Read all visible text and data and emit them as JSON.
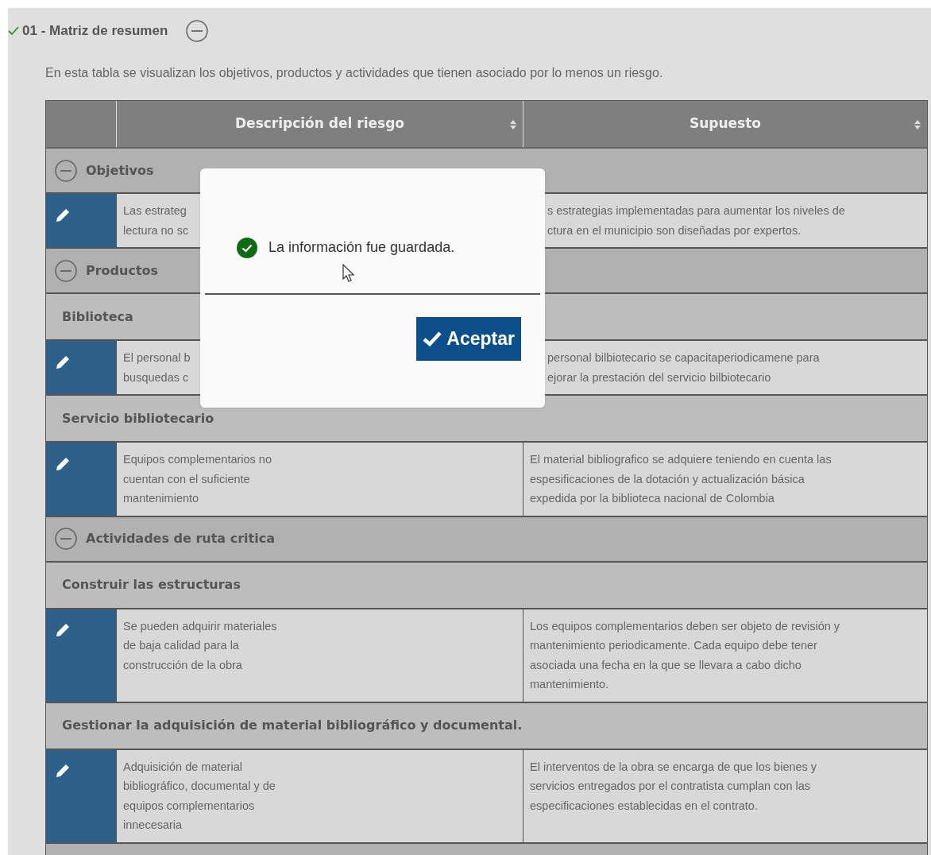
{
  "section": {
    "title": "01 - Matriz de resumen",
    "completed": true,
    "expanded": true
  },
  "description": "En esta tabla se visualizan los objetivos, productos y actividades que tienen asociado por lo menos un riesgo.",
  "table": {
    "columns": [
      "Descripción del riesgo",
      "Supuesto"
    ],
    "rows": [
      {
        "kind": "group",
        "label": "Objetivos",
        "expanded": true
      },
      {
        "kind": "risk",
        "covered": true,
        "risk": "Las estrateg\nlectura no sc",
        "assumption": "s estrategias implementadas para aumentar los niveles de\nctura en el municipio son diseñadas por expertos."
      },
      {
        "kind": "group",
        "label": "Productos",
        "expanded": true
      },
      {
        "kind": "subgroup",
        "label": "Biblioteca"
      },
      {
        "kind": "risk",
        "covered": true,
        "risk": "El personal b\nbusquedas c",
        "assumption": "personal bilbiotecario se capacitaperiodicamene para\nejorar la prestación del servicio bilbiotecario"
      },
      {
        "kind": "subgroup",
        "label": "Servicio bibliotecario"
      },
      {
        "kind": "risk",
        "covered": false,
        "risk": "Equipos complementarios no\ncuentan con el suficiente\nmantenimiento",
        "assumption": "El material bibliografico se adquiere teniendo en cuenta las\nespesificaciones de la dotación y actualización básica\nexpedida por la biblioteca nacional de Colombia"
      },
      {
        "kind": "group",
        "label": "Actividades de ruta critica",
        "expanded": true
      },
      {
        "kind": "subgroup",
        "label": "Construir las estructuras"
      },
      {
        "kind": "risk",
        "covered": false,
        "risk": "Se pueden adquirir materiales\nde baja calidad para la\nconstrucción de la obra",
        "assumption": "Los equipos complementarios deben ser objeto de revisión y\nmantenimiento periodicamente. Cada equipo debe tener\nasociada una fecha en la que se llevara a cabo dicho\nmantenimiento."
      },
      {
        "kind": "subgroup",
        "label": "Gestionar la adquisición de material bibliográfico y documental."
      },
      {
        "kind": "risk",
        "covered": false,
        "risk": "Adquisición de material\nbibliográfico, documental y de\nequipos complementarios\ninnecesaria",
        "assumption": "El interventos de la obra se encarga de que los bienes y\nservicios entregados por el contratista cumplan con las\nespecificaciones establecidas en el contrato."
      },
      {
        "kind": "cut"
      }
    ]
  },
  "dialog": {
    "message": "La información fue guardada.",
    "button": "Aceptar"
  }
}
